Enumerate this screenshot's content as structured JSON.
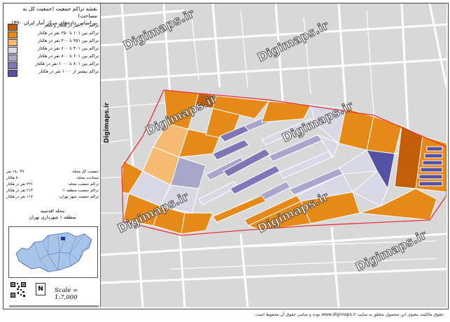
{
  "map": {
    "title_lines": [
      "نقشه تراکم جمعیت (جمعیت کل به مساحت)",
      "بر اساس داده‌های مرکز آمار ایران ۱۳۹۰"
    ],
    "scale_text": "Scale = 1:7,000",
    "north_label": "N",
    "region_label": "محله اقدسیه",
    "district_label": "منطقه ۱ شهرداری تهران",
    "watermark": "Digimaps.ir",
    "footer": "حقوق مالکیت معنوی این محصول متعلق به سایت www.digimaps.ir بوده و تمامی حقوق آن محفوظ است."
  },
  "legend": {
    "items": [
      {
        "label": "تراکم ۱۰۰ نفر در هکتار و کمتر",
        "color": "#c25e08"
      },
      {
        "label": "تراکم بین ۱۰۱ تا ۲۵۰ نفر در هکتار",
        "color": "#e58a18"
      },
      {
        "label": "تراکم بین ۲۵۱ تا ۴۰۰ نفر در هکتار",
        "color": "#f6bb72"
      },
      {
        "label": "تراکم بین ۴۰۱ تا ۶۰۰ نفر در هکتار",
        "color": "#d9d8e6"
      },
      {
        "label": "تراکم بین ۶۰۱ تا ۸۰۰ نفر در هکتار",
        "color": "#a9a6cc"
      },
      {
        "label": "تراکم بین ۸۰۱ تا ۱۰۰۰ نفر در هکتار",
        "color": "#7f77b5"
      },
      {
        "label": "تراکم بیشتر از ۱۰۰۰ نفر در هکتار",
        "color": "#5552a6"
      }
    ]
  },
  "stats": [
    {
      "label": "جمعیت کل محله:",
      "value": "۱۸,۰۲۹ نفر"
    },
    {
      "label": "مساحت محله:",
      "value": "۸۰ هکتار"
    },
    {
      "label": "تراکم جمعیت محله:",
      "value": "۲۲۶ نفر در هکتار"
    },
    {
      "label": "تراکم جمعیت منطقه ۱:",
      "value": "۲۱۳ نفر در هکتار"
    },
    {
      "label": "تراکم جمعیت شهر تهران:",
      "value": "۱۱۷ نفر در هکتار"
    }
  ],
  "colors": {
    "boundary": "#e8323c",
    "road": "#ffffff",
    "background": "#d8d8d8",
    "inset_fill": "#a9c4ea",
    "inset_highlight": "#1c3d8c"
  }
}
